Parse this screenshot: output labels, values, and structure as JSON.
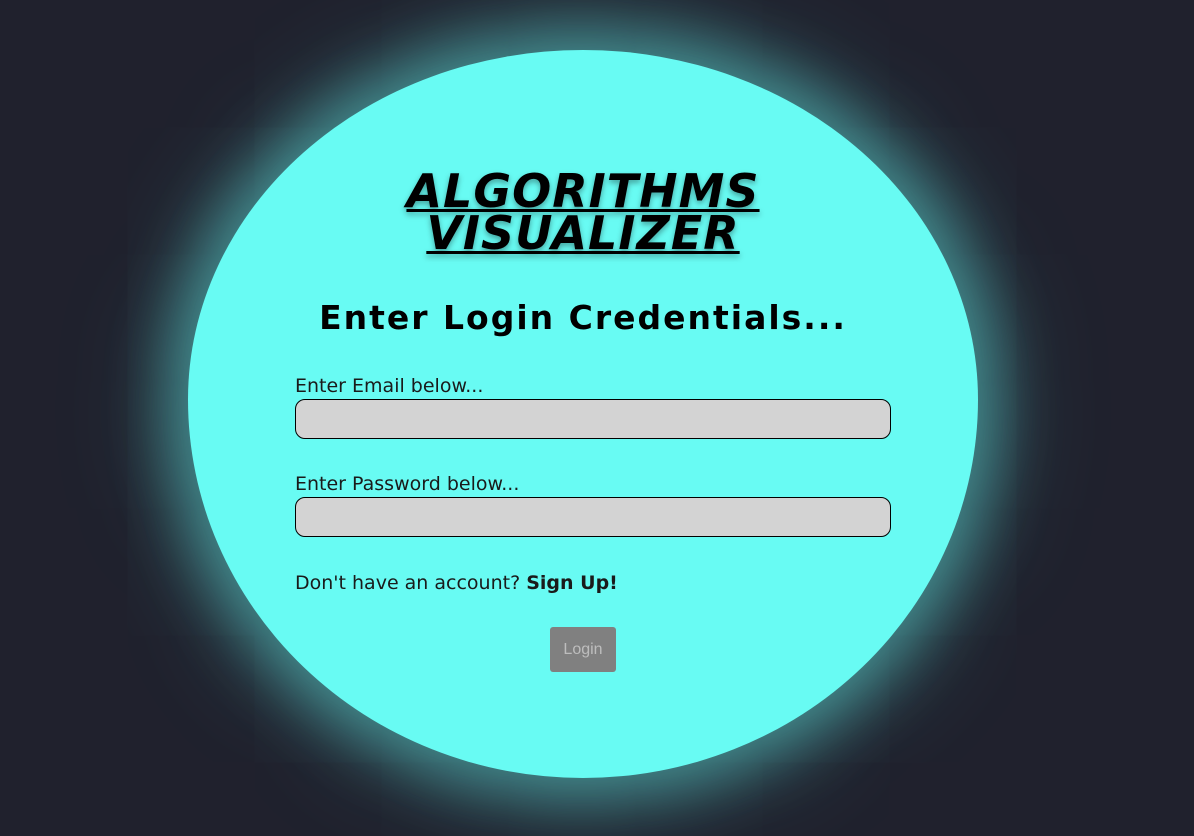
{
  "app": {
    "title_line1": "ALGORITHMS",
    "title_line2": "VISUALIZER",
    "subtitle": "Enter Login Credentials..."
  },
  "form": {
    "email_label": "Enter Email below...",
    "email_value": "",
    "password_label": "Enter Password below...",
    "password_value": "",
    "signup_prompt": "Don't have an account?",
    "signup_link": "Sign Up!",
    "login_button": "Login"
  },
  "colors": {
    "background": "#20212d",
    "panel": "#68fbf3",
    "input_fill": "#d3d3d3",
    "button_disabled": "#808080"
  }
}
